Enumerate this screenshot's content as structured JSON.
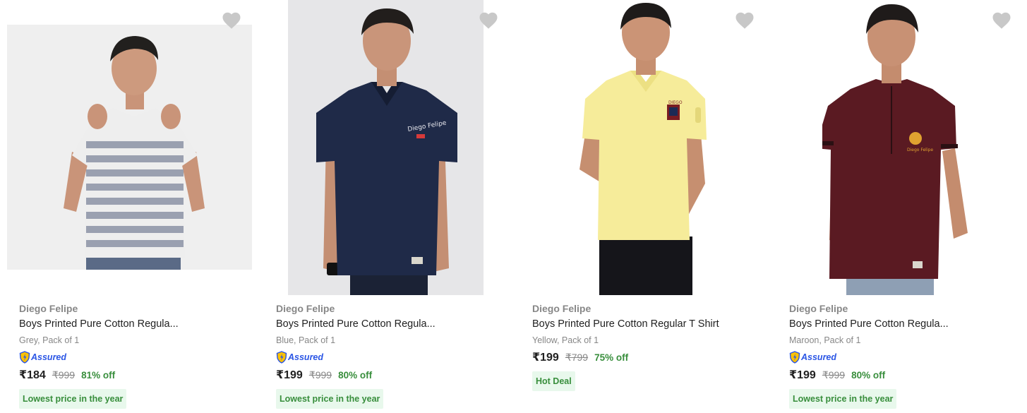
{
  "colors": {
    "brand_text": "#878787",
    "assured_blue": "#2a55e5",
    "discount_green": "#388e3c",
    "deal_bg": "#e8f8ec",
    "wishlist_heart": "#c8c8c8"
  },
  "products": [
    {
      "brand": "Diego Felipe",
      "title": "Boys Printed Pure Cotton Regula...",
      "variant": "Grey, Pack of 1",
      "assured": "Assured",
      "price": "₹184",
      "mrp": "₹999",
      "discount": "81% off",
      "deal": "Lowest price in the year",
      "shirt_color": "#eeeeee",
      "stripe_color": "#9aa0b0",
      "image_bg": "#efefef"
    },
    {
      "brand": "Diego Felipe",
      "title": "Boys Printed Pure Cotton Regula...",
      "variant": "Blue, Pack of 1",
      "assured": "Assured",
      "price": "₹199",
      "mrp": "₹999",
      "discount": "80% off",
      "deal": "Lowest price in the year",
      "shirt_color": "#1f2a48",
      "image_bg": "#e6e6e8"
    },
    {
      "brand": "Diego Felipe",
      "title": "Boys Printed Pure Cotton Regular T Shirt",
      "variant": "Yellow, Pack of 1",
      "assured": "",
      "price": "₹199",
      "mrp": "₹799",
      "discount": "75% off",
      "deal": "Hot Deal",
      "shirt_color": "#f6ec9a",
      "image_bg": "#ffffff"
    },
    {
      "brand": "Diego Felipe",
      "title": "Boys Printed Pure Cotton Regula...",
      "variant": "Maroon, Pack of 1",
      "assured": "Assured",
      "price": "₹199",
      "mrp": "₹999",
      "discount": "80% off",
      "deal": "Lowest price in the year",
      "shirt_color": "#5a1a22",
      "image_bg": "#ffffff"
    }
  ]
}
